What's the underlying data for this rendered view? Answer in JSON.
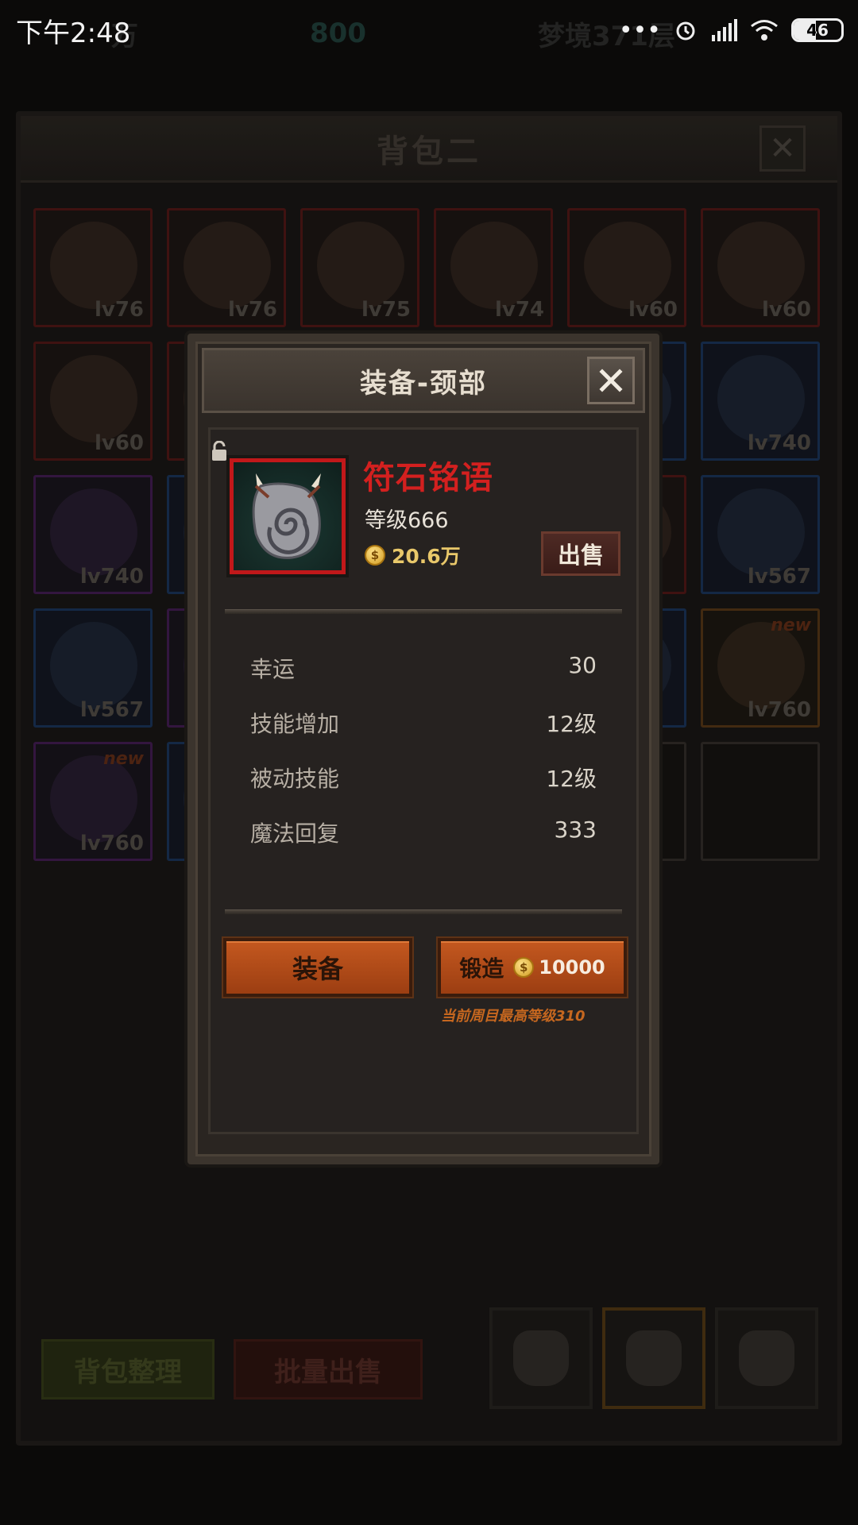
{
  "status_bar": {
    "time": "下午2:48",
    "battery": "46"
  },
  "background": {
    "top_stats": {
      "gold": "万",
      "gems": "800",
      "floor": "梦境371层"
    },
    "bag": {
      "title": "背包二",
      "slots": [
        {
          "lv": "lv76",
          "rarity": "red"
        },
        {
          "lv": "lv76",
          "rarity": "red"
        },
        {
          "lv": "lv75",
          "rarity": "red"
        },
        {
          "lv": "lv74",
          "rarity": "red"
        },
        {
          "lv": "lv60",
          "rarity": "red"
        },
        {
          "lv": "lv60",
          "rarity": "red"
        },
        {
          "lv": "lv60",
          "rarity": "red"
        },
        {
          "lv": "",
          "rarity": "red"
        },
        {
          "lv": "",
          "rarity": "red"
        },
        {
          "lv": "",
          "rarity": "red"
        },
        {
          "lv": "",
          "rarity": "blue"
        },
        {
          "lv": "lv740",
          "rarity": "blue"
        },
        {
          "lv": "lv740",
          "rarity": "purple"
        },
        {
          "lv": "",
          "rarity": "blue"
        },
        {
          "lv": "",
          "rarity": "red"
        },
        {
          "lv": "",
          "rarity": "red"
        },
        {
          "lv": "",
          "rarity": "red"
        },
        {
          "lv": "lv567",
          "rarity": "blue"
        },
        {
          "lv": "lv567",
          "rarity": "blue"
        },
        {
          "lv": "",
          "rarity": "purple"
        },
        {
          "lv": "",
          "rarity": "red"
        },
        {
          "lv": "",
          "rarity": "red"
        },
        {
          "lv": "",
          "rarity": "blue"
        },
        {
          "lv": "lv760",
          "rarity": "orange",
          "new": "new"
        },
        {
          "lv": "lv760",
          "rarity": "purple",
          "new": "new"
        },
        {
          "lv": "",
          "rarity": "blue"
        },
        {
          "lv": "",
          "rarity": "empty"
        },
        {
          "lv": "",
          "rarity": "empty"
        },
        {
          "lv": "",
          "rarity": "empty"
        },
        {
          "lv": "",
          "rarity": "empty"
        }
      ],
      "sort_label": "背包整理",
      "batch_sell_label": "批量出售"
    }
  },
  "modal": {
    "title": "装备-颈部",
    "item": {
      "name": "符石铭语",
      "level": "等级666",
      "price": "20.6万"
    },
    "sell_label": "出售",
    "stats": [
      {
        "name": "幸运",
        "value": "30"
      },
      {
        "name": "技能增加",
        "value": "12级"
      },
      {
        "name": "被动技能",
        "value": "12级"
      },
      {
        "name": "魔法回复",
        "value": "333"
      }
    ],
    "equip_label": "装备",
    "forge_label": "锻造",
    "forge_cost": "10000",
    "forge_note": "当前周目最高等级310"
  },
  "colors": {
    "item_name": "#d3201f",
    "accent_orange": "#c4581f",
    "gold": "#e9c86a"
  }
}
